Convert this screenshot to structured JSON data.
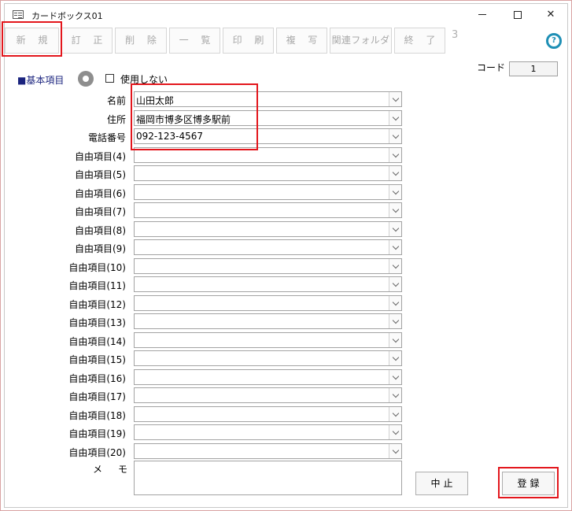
{
  "window": {
    "title": "カードボックス01",
    "controls": {
      "minimize": "minimize",
      "maximize": "maximize",
      "close": "✕"
    }
  },
  "toolbar": {
    "buttons": [
      "新 規",
      "訂 正",
      "削 除",
      "一 覧",
      "印 刷",
      "複 写",
      "関連フォルダ",
      "終 了"
    ],
    "number": "3"
  },
  "help": {
    "icon": "question-icon",
    "text": "?"
  },
  "code": {
    "label": "コード",
    "value": "1"
  },
  "section": {
    "title": "■基本項目",
    "gear_icon": "gear-icon",
    "checkbox_label": "使用しない",
    "checkbox_checked": false
  },
  "fields": [
    {
      "label": "名前",
      "value": "山田太郎"
    },
    {
      "label": "住所",
      "value": "福岡市博多区博多駅前"
    },
    {
      "label": "電話番号",
      "value": "092-123-4567"
    },
    {
      "label": "自由項目(4)",
      "value": ""
    },
    {
      "label": "自由項目(5)",
      "value": ""
    },
    {
      "label": "自由項目(6)",
      "value": ""
    },
    {
      "label": "自由項目(7)",
      "value": ""
    },
    {
      "label": "自由項目(8)",
      "value": ""
    },
    {
      "label": "自由項目(9)",
      "value": ""
    },
    {
      "label": "自由項目(10)",
      "value": ""
    },
    {
      "label": "自由項目(11)",
      "value": ""
    },
    {
      "label": "自由項目(12)",
      "value": ""
    },
    {
      "label": "自由項目(13)",
      "value": ""
    },
    {
      "label": "自由項目(14)",
      "value": ""
    },
    {
      "label": "自由項目(15)",
      "value": ""
    },
    {
      "label": "自由項目(16)",
      "value": ""
    },
    {
      "label": "自由項目(17)",
      "value": ""
    },
    {
      "label": "自由項目(18)",
      "value": ""
    },
    {
      "label": "自由項目(19)",
      "value": ""
    },
    {
      "label": "自由項目(20)",
      "value": ""
    }
  ],
  "memo": {
    "label": "メモ",
    "value": ""
  },
  "actions": {
    "cancel": "中止",
    "register": "登録"
  },
  "colors": {
    "highlight": "#e3161c",
    "section_title": "#1a237e",
    "help_icon": "#1e8fb5"
  }
}
